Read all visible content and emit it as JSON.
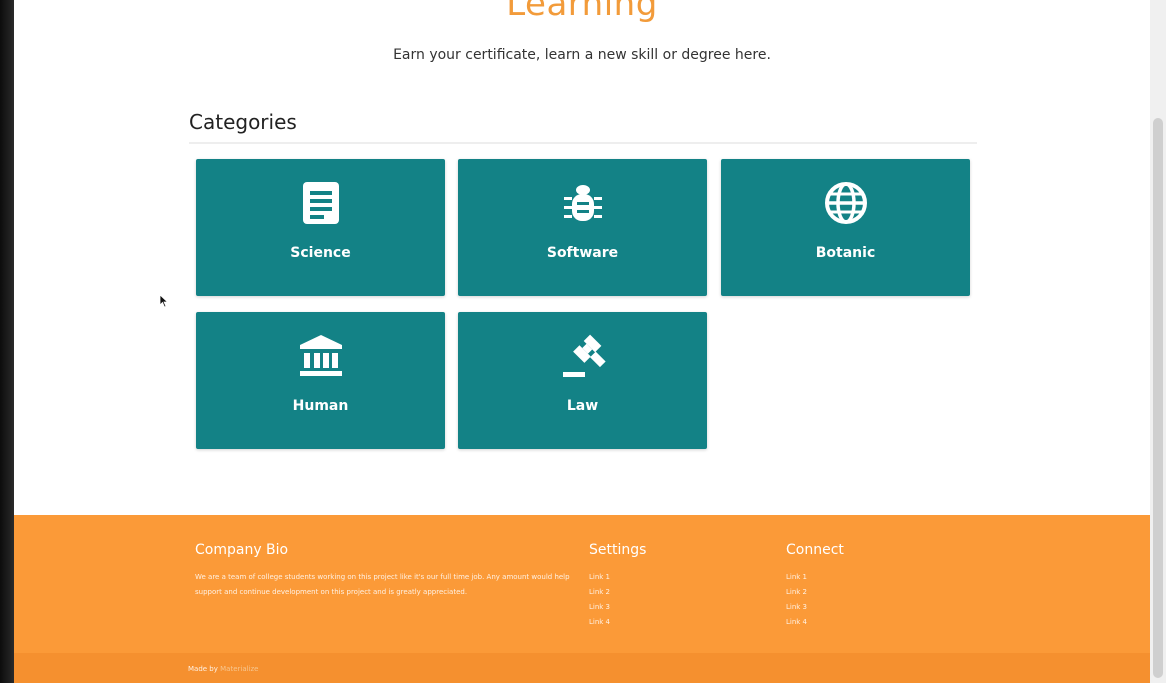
{
  "hero": {
    "title": "Learning",
    "subtitle": "Earn your certificate, learn a new skill or degree here."
  },
  "categories": {
    "heading": "Categories",
    "items": [
      {
        "label": "Science",
        "icon": "document-icon"
      },
      {
        "label": "Software",
        "icon": "bug-icon"
      },
      {
        "label": "Botanic",
        "icon": "globe-icon"
      },
      {
        "label": "Human",
        "icon": "institution-icon"
      },
      {
        "label": "Law",
        "icon": "gavel-icon"
      }
    ]
  },
  "footer": {
    "bio_title": "Company Bio",
    "bio_text": "We are a team of college students working on this project like it's our full time job. Any amount would help support and continue development on this project and is greatly appreciated.",
    "settings_title": "Settings",
    "settings_links": [
      "Link 1",
      "Link 2",
      "Link 3",
      "Link 4"
    ],
    "connect_title": "Connect",
    "connect_links": [
      "Link 1",
      "Link 2",
      "Link 3",
      "Link 4"
    ],
    "credit_prefix": "Made by",
    "credit_link": "Materialize"
  },
  "colors": {
    "tile": "#138286",
    "accent": "#f29b3a",
    "footer": "#fb9a38"
  }
}
